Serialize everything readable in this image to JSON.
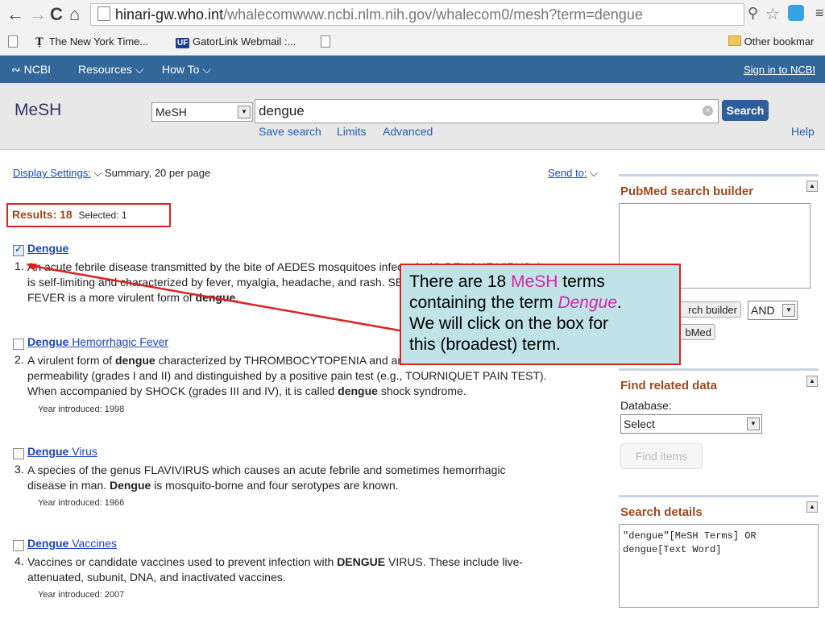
{
  "browser": {
    "url_host": "hinari-gw.who.int",
    "url_path": "/whalecomwww.ncbi.nlm.nih.gov/whalecom0/mesh?term=dengue",
    "bookmarks": [
      "The New York Time...",
      "GatorLink Webmail :..."
    ],
    "other_bookmarks": "Other bookmar"
  },
  "ncbi_bar": {
    "logo": "NCBI",
    "resources": "Resources",
    "howto": "How To",
    "signin": "Sign in to NCBI"
  },
  "search": {
    "title": "MeSH",
    "db": "MeSH",
    "query": "dengue",
    "button": "Search",
    "save_search": "Save search",
    "limits": "Limits",
    "advanced": "Advanced",
    "help": "Help"
  },
  "display": {
    "settings_label": "Display Settings:",
    "settings_value": "Summary, 20 per page",
    "send_to": "Send to:"
  },
  "results": {
    "count_label": "Results: 18",
    "selected": "Selected: 1",
    "items": [
      {
        "num": "1.",
        "title_bold": "Dengue",
        "title_rest": "",
        "checked": true,
        "desc1": "An acute febrile disease transmitted by the bite of AEDES mosquitoes infected with DENGUE VIRUS. It",
        "desc2": "is self-limiting and characterized by fever, myalgia, headache, and rash. SEVERE DENGUE is a more",
        "desc3_pre": "FEVER is a more virulent form of ",
        "desc3_bold": "dengue",
        "desc3_post": ".",
        "year": ""
      },
      {
        "num": "2.",
        "title_bold": "Dengue",
        "title_rest": " Hemorrhagic Fever",
        "checked": false,
        "desc1_pre": "A virulent form of ",
        "desc1_bold": "dengue",
        "desc1_post": " characterized by THROMBOCYTOPENIA and an increase in vascular",
        "desc2": "permeability (grades I and II) and distinguished by a positive pain test (e.g., TOURNIQUET PAIN TEST).",
        "desc3_pre": "When accompanied by SHOCK (grades III and IV), it is called ",
        "desc3_bold": "dengue",
        "desc3_post": " shock syndrome.",
        "year": "Year introduced: 1998"
      },
      {
        "num": "3.",
        "title_bold": "Dengue",
        "title_rest": " Virus",
        "checked": false,
        "desc1": "A species of the genus FLAVIVIRUS which causes an acute febrile and sometimes hemorrhagic",
        "desc2_pre": "disease in man. ",
        "desc2_bold": "Dengue",
        "desc2_post": " is mosquito-borne and four serotypes are known.",
        "year": "Year introduced: 1966"
      },
      {
        "num": "4.",
        "title_bold": "Dengue",
        "title_rest": " Vaccines",
        "checked": false,
        "desc1_pre": "Vaccines or candidate vaccines used to prevent infection with ",
        "desc1_bold": "DENGUE",
        "desc1_post": " VIRUS. These include live-",
        "desc2": "attenuated, subunit, DNA, and inactivated vaccines.",
        "year": "Year introduced: 2007"
      }
    ]
  },
  "sidebar": {
    "builder_title": "PubMed search builder",
    "add_builder": "rch builder",
    "and": "AND",
    "search_pubmed": "bMed",
    "related_title": "Find related data",
    "database_label": "Database:",
    "database_value": "Select",
    "find_items": "Find items",
    "details_title": "Search details",
    "details_text": "\"dengue\"[MeSH Terms] OR dengue[Text Word]"
  },
  "callout": {
    "line1_pre": "There are 18 ",
    "line1_mesh": "MeSH",
    "line1_post": " terms",
    "line2_pre": "containing the term ",
    "line2_dengue": "Dengue",
    "line2_post": ".",
    "line3": "We will click on the box for",
    "line4": "this (broadest) term."
  }
}
